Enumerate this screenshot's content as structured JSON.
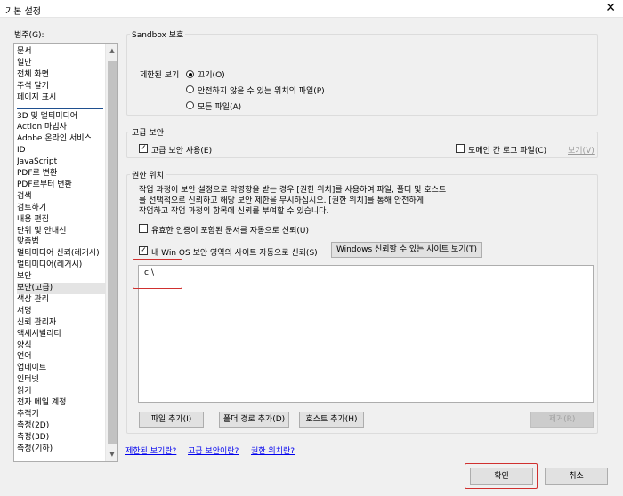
{
  "window": {
    "title": "기본 설정",
    "close_glyph": "✕"
  },
  "categories": {
    "label": "범주(G):",
    "items": [
      "문서",
      "일반",
      "전체 화면",
      "주석 달기",
      "페이지 표시",
      "3D 및 멀티미디어",
      "Action 마법사",
      "Adobe 온라인 서비스",
      "ID",
      "JavaScript",
      "PDF로 변환",
      "PDF로부터 변환",
      "검색",
      "검토하기",
      "내용 편집",
      "단위 및 안내선",
      "맞춤법",
      "멀티미디어 신뢰(레거시)",
      "멀티미디어(레거시)",
      "보안",
      "보안(고급)",
      "색상 관리",
      "서명",
      "신뢰 관리자",
      "액세서빌리티",
      "양식",
      "언어",
      "업데이트",
      "인터넷",
      "읽기",
      "전자 메일 계정",
      "추적기",
      "측정(2D)",
      "측정(3D)",
      "측정(기하)"
    ],
    "selected": "보안(고급)"
  },
  "sandbox": {
    "title": "Sandbox 보호",
    "protected_view_label": "제한된 보기",
    "options": [
      "끄기(O)",
      "안전하지 않을 수 있는 위치의 파일(P)",
      "모든 파일(A)"
    ],
    "selected_index": 0
  },
  "enhanced": {
    "title": "고급 보안",
    "enable_label": "고급 보안 사용(E)",
    "enable_checked": true,
    "cross_domain_label": "도메인 간 로그 파일(C)",
    "cross_domain_checked": false,
    "view_link": "보기(V)"
  },
  "privileged": {
    "title": "권한 위치",
    "description": [
      "작업 과정이 보안 설정으로 악영향을 받는 경우 [권한 위치]를 사용하여 파일, 폴더 및 호스트",
      "를 선택적으로 신뢰하고 해당 보안 제한을 무시하십시오. [권한 위치]를 통해 안전하게",
      "작업하고 작업 과정의 항목에 신뢰를 부여할 수 있습니다."
    ],
    "certified_label": "유효한 인증이 포함된 문서를 자동으로 신뢰(U)",
    "certified_checked": false,
    "win_os_label": "내 Win OS 보안 영역의 사이트 자동으로 신뢰(S)",
    "win_os_checked": true,
    "view_windows_sites_button": "Windows 신뢰할 수 있는 사이트 보기(T)",
    "paths": [
      "c:\\"
    ],
    "add_file_button": "파일 추가(I)",
    "add_folder_button": "폴더 경로 추가(D)",
    "add_host_button": "호스트 추가(H)",
    "remove_button": "제거(R)"
  },
  "links": {
    "protected_view": "제한된 보기란?",
    "enhanced_security": "고급 보안이란?",
    "privileged_locations": "권한 위치란?"
  },
  "footer": {
    "ok_button": "확인",
    "cancel_button": "취소"
  },
  "colors": {
    "highlight_red": "#d0302f",
    "link_blue": "#0000ee"
  }
}
